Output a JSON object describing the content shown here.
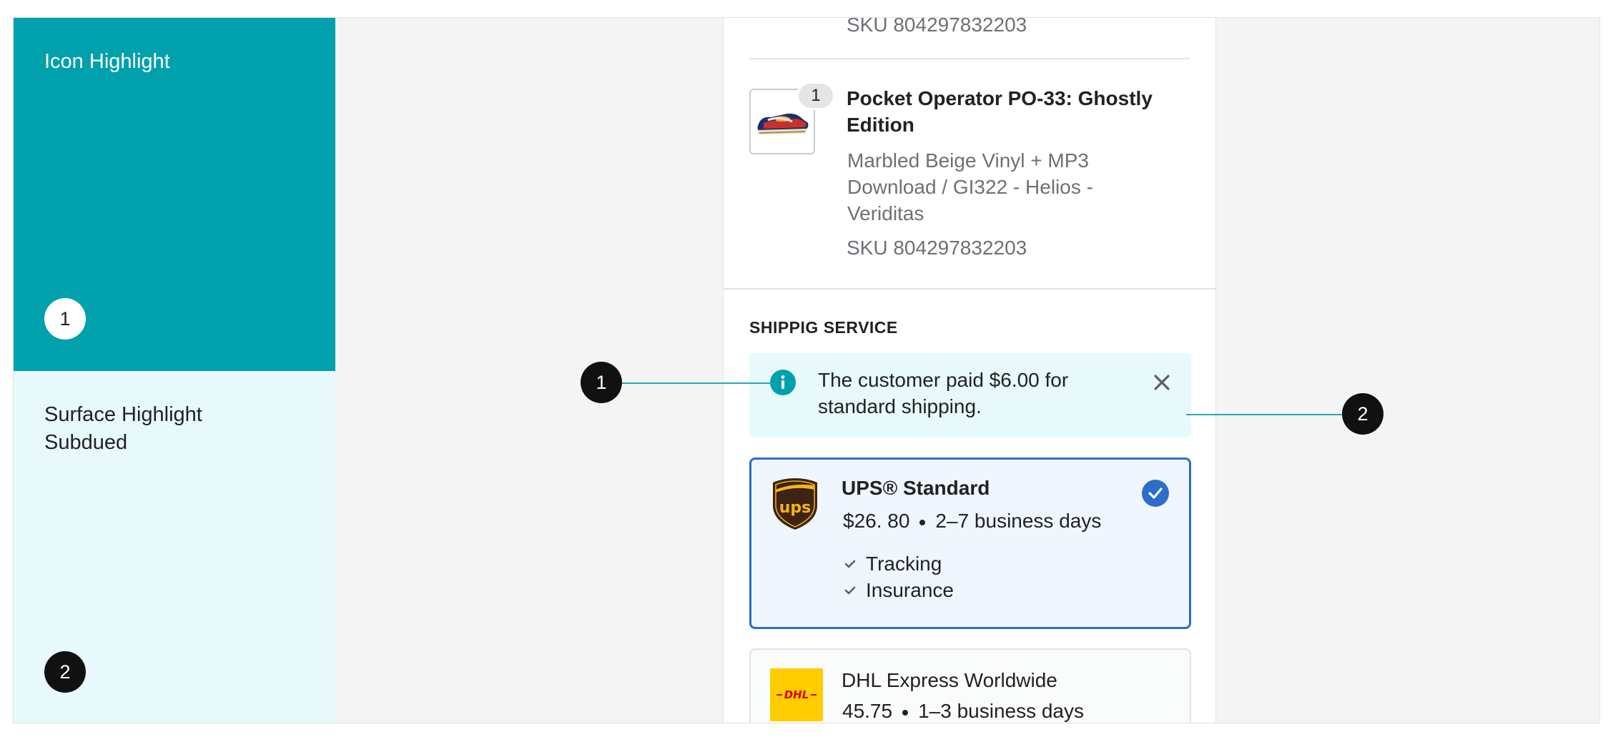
{
  "swatches": {
    "icon_highlight": {
      "title": "Icon Highlight",
      "number": "1",
      "color": "#00a0ac"
    },
    "surface_highlight": {
      "title": "Surface Highlight Subdued",
      "number": "2",
      "color": "#e8f9fb"
    }
  },
  "panel": {
    "previous_item_sku": "SKU 804297832203",
    "product": {
      "quantity": "1",
      "name": "Pocket Operator PO-33: Ghostly Edition",
      "variant": "Marbled Beige Vinyl + MP3 Download / GI322 - Helios - Veriditas",
      "sku": "SKU 804297832203"
    },
    "shipping": {
      "heading": "SHIPPIG SERVICE",
      "banner": {
        "text": "The customer paid $6.00 for standard shipping.",
        "icon": "info-icon"
      },
      "rates": [
        {
          "name": "UPS® Standard",
          "price": "$26. 80",
          "delivery": "2–7 business days",
          "features": [
            "Tracking",
            "Insurance"
          ],
          "selected": true,
          "logo": "ups-logo"
        },
        {
          "name": "DHL Express Worldwide",
          "price": "45.75",
          "delivery": "1–3 business days",
          "selected": false,
          "logo": "dhl-logo"
        }
      ]
    }
  },
  "callouts": {
    "left": "1",
    "right": "2"
  },
  "colors": {
    "accent_teal": "#00a0ac",
    "callout_line": "#2aa8b3",
    "selected_border": "#2c6ecb",
    "selected_bg": "#f0f6fe",
    "dhl_yellow": "#ffcc00",
    "ups_brown": "#3d2314"
  }
}
